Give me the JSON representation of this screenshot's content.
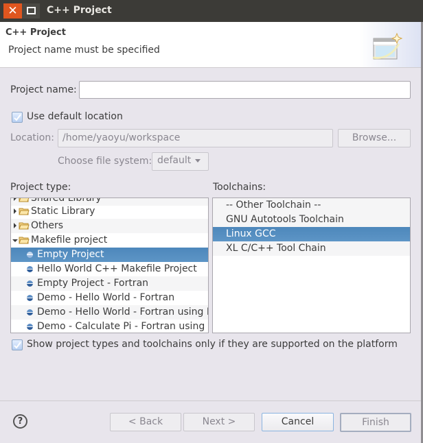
{
  "window": {
    "title": "C++ Project",
    "close_icon": "close-icon",
    "maximize_icon": "maximize-icon"
  },
  "header": {
    "title": "C++ Project",
    "message": "Project name must be specified",
    "icon": "new-project-wizard-icon"
  },
  "form": {
    "project_name_label": "Project name:",
    "project_name_value": "",
    "use_default_location_label": "Use default location",
    "use_default_location_checked": true,
    "location_label": "Location:",
    "location_value": "/home/yaoyu/workspace",
    "browse_label": "Browse...",
    "file_system_label": "Choose file system:",
    "file_system_value": "default"
  },
  "project_type": {
    "label": "Project type:",
    "items": [
      {
        "label": "Shared Library",
        "kind": "folder",
        "expanded": false
      },
      {
        "label": "Static Library",
        "kind": "folder",
        "expanded": false
      },
      {
        "label": "Others",
        "kind": "folder",
        "expanded": false
      },
      {
        "label": "Makefile project",
        "kind": "folder",
        "expanded": true
      },
      {
        "label": "Empty Project",
        "kind": "leaf",
        "selected": true
      },
      {
        "label": "Hello World C++ Makefile Project",
        "kind": "leaf"
      },
      {
        "label": "Empty Project - Fortran",
        "kind": "leaf"
      },
      {
        "label": "Demo - Hello World - Fortran",
        "kind": "leaf"
      },
      {
        "label": "Demo - Hello World - Fortran using M",
        "kind": "leaf"
      },
      {
        "label": "Demo - Calculate Pi - Fortran using M",
        "kind": "leaf"
      }
    ]
  },
  "toolchains": {
    "label": "Toolchains:",
    "items": [
      {
        "label": "-- Other Toolchain --"
      },
      {
        "label": "GNU Autotools Toolchain"
      },
      {
        "label": "Linux GCC",
        "selected": true
      },
      {
        "label": "XL C/C++ Tool Chain"
      }
    ]
  },
  "filter": {
    "label": "Show project types and toolchains only if they are supported on the platform",
    "checked": true
  },
  "buttons": {
    "back": "< Back",
    "next": "Next >",
    "cancel": "Cancel",
    "finish": "Finish",
    "help_icon": "help-icon"
  },
  "colors": {
    "selection": "#4a84b8",
    "close_button": "#e0561f",
    "titlebar": "#3c3b37"
  }
}
